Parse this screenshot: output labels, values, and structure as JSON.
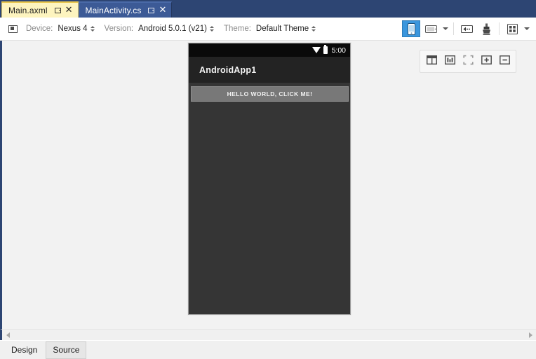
{
  "window": {
    "tabs": [
      {
        "label": "Main.axml",
        "active": true,
        "pin_icon": "pin-icon",
        "close_icon": "close-icon"
      },
      {
        "label": "MainActivity.cs",
        "active": false,
        "pin_icon": "pin-icon",
        "close_icon": "close-icon"
      }
    ]
  },
  "toolbar": {
    "device_icon": "device-frame-icon",
    "fields": [
      {
        "caption": "Device:",
        "value": "Nexus 4",
        "spinner_icon": "spinner-updown-icon"
      },
      {
        "caption": "Version:",
        "value": "Android 5.0.1 (v21)",
        "spinner_icon": "spinner-updown-icon"
      },
      {
        "caption": "Theme:",
        "value": "Default Theme",
        "spinner_icon": "spinner-updown-icon"
      }
    ],
    "buttons": [
      {
        "name": "portrait-orientation-button",
        "icon": "phone-portrait-icon",
        "selected": true
      },
      {
        "name": "landscape-orientation-button",
        "icon": "phone-landscape-icon",
        "selected": false
      },
      {
        "name": "orientation-dropdown-button",
        "icon": "chevron-down-icon",
        "selected": false
      },
      {
        "name": "rtl-layout-direction-button",
        "icon": "rtl-arrow-icon",
        "selected": false
      },
      {
        "name": "theme-brush-button",
        "icon": "paint-brush-icon",
        "selected": false
      },
      {
        "name": "grid-toggle-button",
        "icon": "grid-icon",
        "selected": false
      }
    ]
  },
  "designer": {
    "phone": {
      "status_bar": {
        "wifi_icon": "wifi-signal-icon",
        "battery_icon": "battery-icon",
        "time": "5:00"
      },
      "app_bar": {
        "title": "AndroidApp1"
      },
      "widgets": [
        {
          "name": "hello-world-button",
          "label": "HELLO WORLD, CLICK ME!"
        }
      ]
    },
    "zoom_toolbar": [
      {
        "name": "zoom-to-fit-width-button",
        "icon": "fit-width-icon"
      },
      {
        "name": "zoom-to-actual-size-button",
        "icon": "actual-size-icon"
      },
      {
        "name": "zoom-to-fit-button",
        "icon": "fit-screen-icon"
      },
      {
        "name": "zoom-in-button",
        "icon": "plus-box-icon"
      },
      {
        "name": "zoom-out-button",
        "icon": "minus-box-icon"
      }
    ],
    "scrollbar": {
      "left_arrow_icon": "arrow-left-icon",
      "right_arrow_icon": "arrow-right-icon"
    }
  },
  "view_tabs": [
    {
      "label": "Design",
      "selected": false
    },
    {
      "label": "Source",
      "selected": true
    }
  ],
  "colors": {
    "tab_active_bg": "#fdf4bf",
    "tab_strip_bg": "#2d4573",
    "accent_selected": "#3a96dd",
    "canvas_bg": "#f2f2f2",
    "phone_body": "#353535",
    "app_bar": "#232323"
  }
}
